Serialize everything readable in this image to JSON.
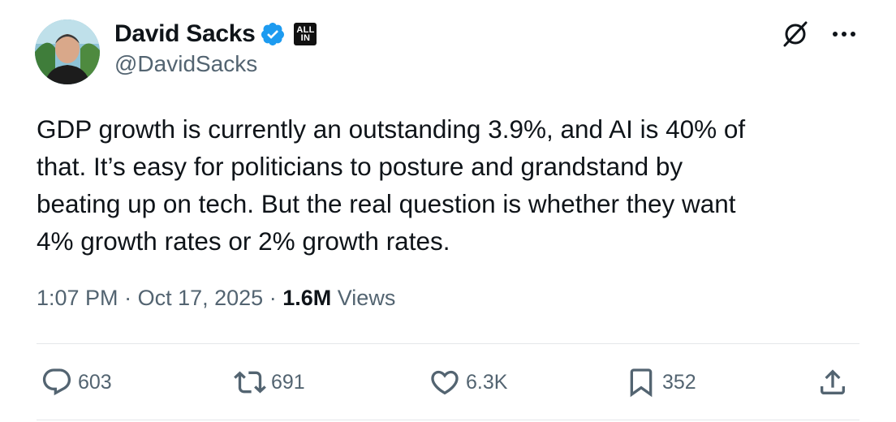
{
  "author": {
    "name": "David Sacks",
    "handle": "@DavidSacks",
    "affiliate_badge": "ALL IN",
    "affiliate_badge_line1": "ALL",
    "affiliate_badge_line2": "IN"
  },
  "tweet": {
    "text": "GDP growth is currently an outstanding 3.9%, and AI is 40% of\nthat. It’s easy for politicians to posture and grandstand by\nbeating up on tech. But the real question is whether they want\n4% growth rates or 2% growth rates."
  },
  "meta": {
    "time": "1:07 PM",
    "separator": "·",
    "date": "Oct 17, 2025",
    "views_count": "1.6M",
    "views_label": "Views"
  },
  "actions": {
    "replies": "603",
    "reposts": "691",
    "likes": "6.3K",
    "bookmarks": "352"
  },
  "icons": {
    "verified": "verified-badge-icon",
    "grok": "grok-icon",
    "more": "more-icon",
    "reply": "reply-icon",
    "repost": "repost-icon",
    "like": "heart-icon",
    "bookmark": "bookmark-icon",
    "share": "share-icon"
  },
  "colors": {
    "verified_blue": "#1d9bf0",
    "secondary_text": "#536471",
    "primary_text": "#0f1419"
  }
}
